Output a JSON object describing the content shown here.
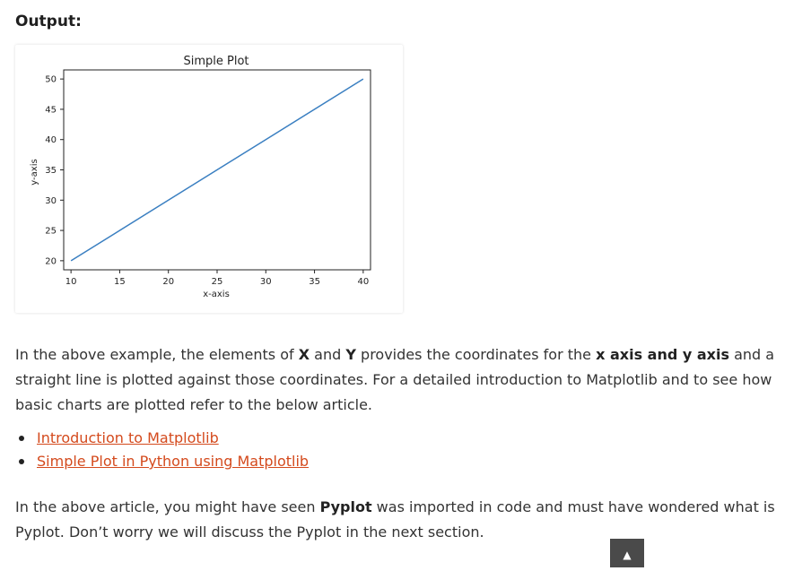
{
  "heading": "Output:",
  "chart_data": {
    "type": "line",
    "title": "Simple Plot",
    "xlabel": "x-axis",
    "ylabel": "y-axis",
    "x": [
      10,
      20,
      30,
      40
    ],
    "series": [
      {
        "values": [
          20,
          30,
          40,
          50
        ],
        "color": "#3a7fc1"
      }
    ],
    "xlim": [
      9.25,
      40.75
    ],
    "ylim": [
      18.5,
      51.5
    ],
    "xticks": [
      10,
      15,
      20,
      25,
      30,
      35,
      40
    ],
    "yticks": [
      20,
      25,
      30,
      35,
      40,
      45,
      50
    ],
    "grid": false
  },
  "paragraph1": {
    "t1": "In the above example, the elements of ",
    "b1": "X",
    "t2": " and ",
    "b2": "Y",
    "t3": " provides the coordinates for the ",
    "b3": "x axis and y axis",
    "t4": " and a straight line is plotted against those coordinates. For a detailed introduction to Matplotlib and to see how basic charts are plotted refer to the below article."
  },
  "links": [
    {
      "label": "Introduction to Matplotlib"
    },
    {
      "label": "Simple Plot in Python using Matplotlib"
    }
  ],
  "paragraph2": {
    "t1": "In the above article, you might have seen ",
    "b1": "Pyplot",
    "t2": " was imported in code and must have wondered what is Pyplot. Don’t worry we will discuss the Pyplot in the next section."
  },
  "scroll_top": {
    "icon": "▲",
    "icon_name": "arrow-up-icon"
  },
  "colors": {
    "link": "#d44a1d",
    "line": "#3a7fc1"
  }
}
